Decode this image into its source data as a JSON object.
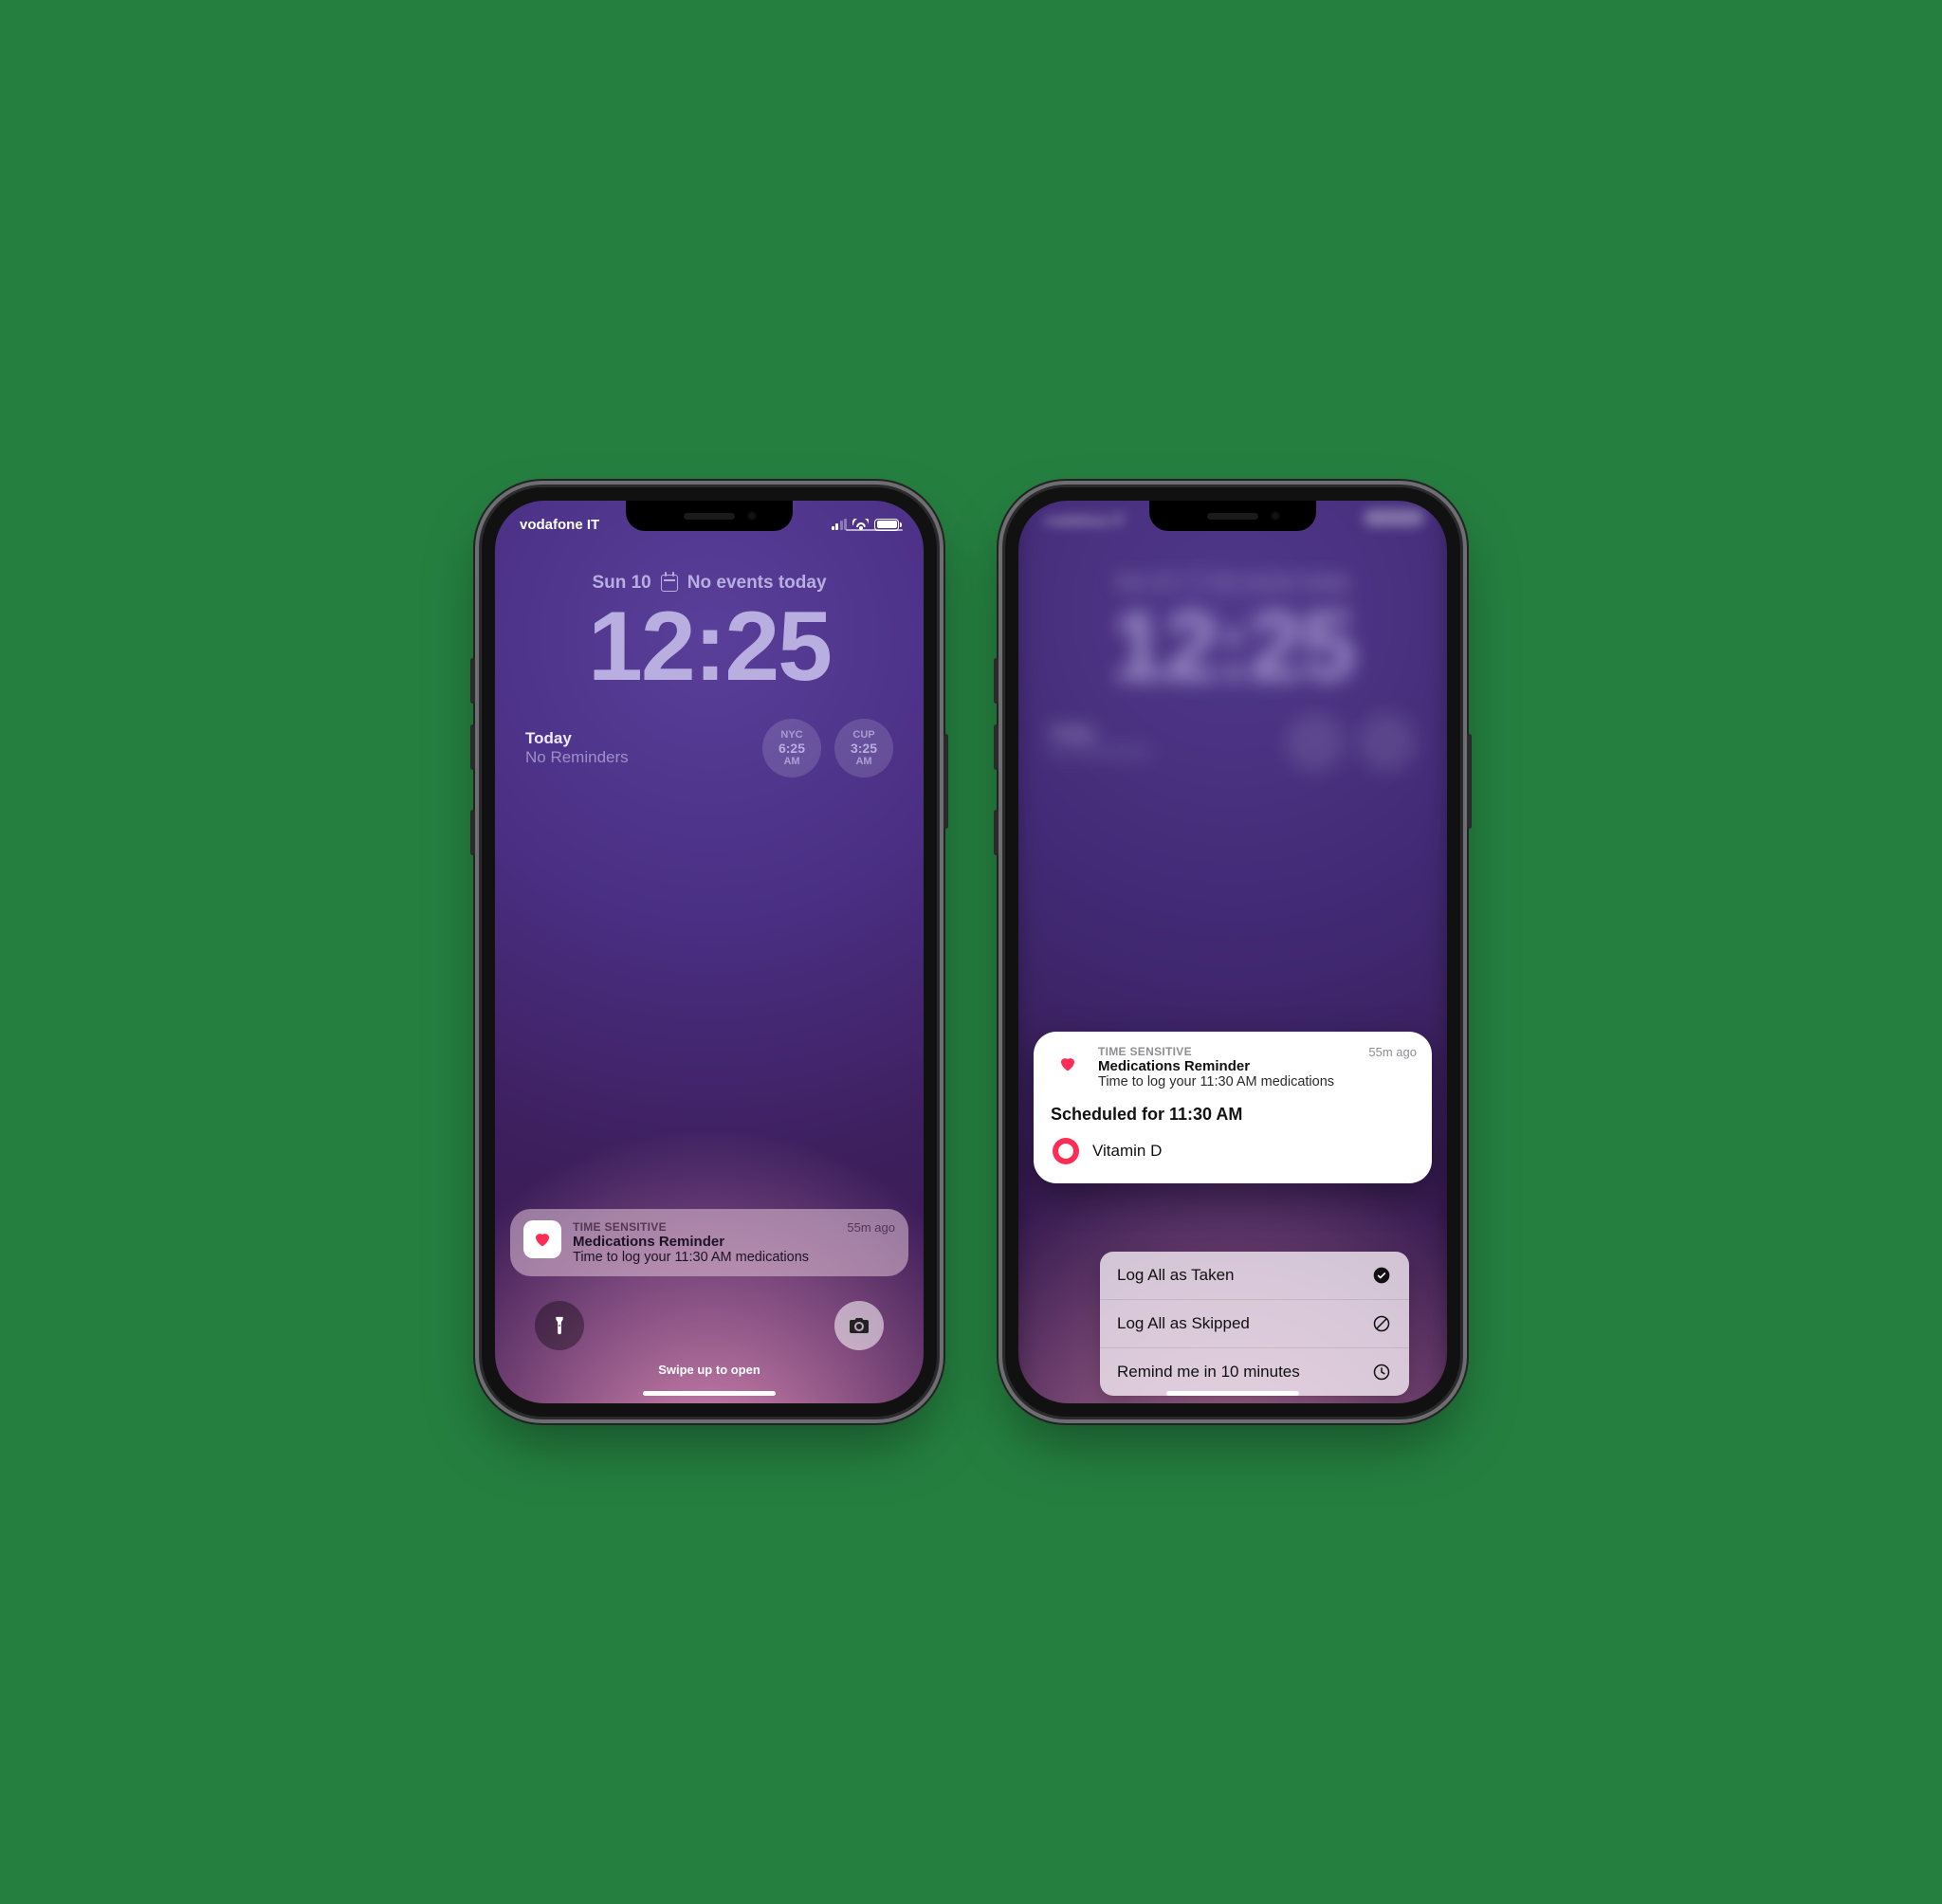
{
  "carrier": "vodafone IT",
  "status": {
    "signal_active_bars": 2
  },
  "date": "Sun 10",
  "calendar_hint": "No events today",
  "time": "12:25",
  "widgets": {
    "today_title": "Today",
    "today_sub": "No Reminders",
    "clocks": [
      {
        "city": "NYC",
        "time": "6:25",
        "ampm": "AM"
      },
      {
        "city": "CUP",
        "time": "3:25",
        "ampm": "AM"
      }
    ]
  },
  "notification": {
    "tag": "TIME SENSITIVE",
    "title": "Medications Reminder",
    "message": "Time to log your 11:30 AM medications",
    "age": "55m ago"
  },
  "swipe_hint": "Swipe up to open",
  "expanded": {
    "scheduled_label": "Scheduled for 11:30 AM",
    "medication": "Vitamin D",
    "actions": {
      "taken": "Log All as Taken",
      "skipped": "Log All as Skipped",
      "remind": "Remind me in 10 minutes"
    }
  },
  "icons": {
    "health": "health-app-icon",
    "flashlight": "flashlight-icon",
    "camera": "camera-icon",
    "check": "check-circle-icon",
    "skip": "prohibited-icon",
    "clock": "clock-icon"
  }
}
